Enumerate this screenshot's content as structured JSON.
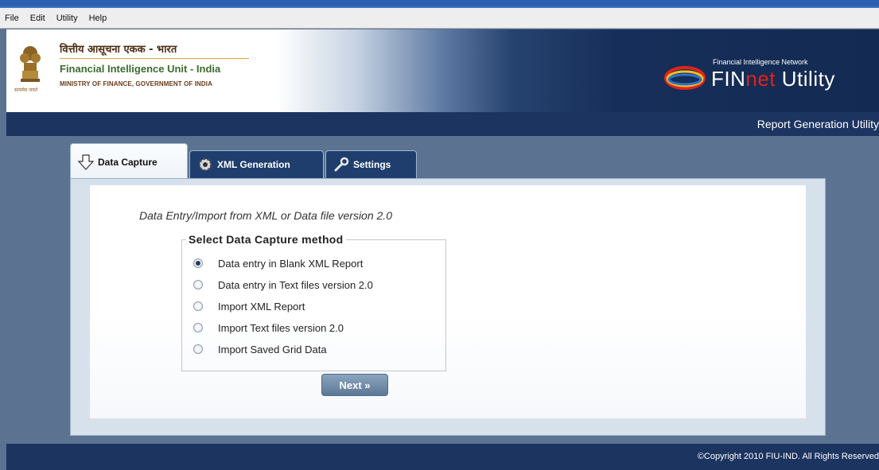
{
  "menu": {
    "file": "File",
    "edit": "Edit",
    "utility": "Utility",
    "help": "Help"
  },
  "header": {
    "hindi_title": "वित्तीय आसूचना एकक - भारत",
    "unit_name": "Financial Intelligence Unit - India",
    "ministry": "MINISTRY OF FINANCE, GOVERNMENT OF INDIA",
    "emblem_caption": "सत्यमेव जयते",
    "network_label": "Financial Intelligence Network",
    "product_fin": "FIN",
    "product_net": "net",
    "product_utility": " Utility"
  },
  "subheader": {
    "title": "Report Generation Utility"
  },
  "tabs": [
    {
      "label": "Data Capture",
      "icon": "down-arrow-icon",
      "active": true
    },
    {
      "label": "XML Generation",
      "icon": "gear-icon",
      "active": false
    },
    {
      "label": "Settings",
      "icon": "wrench-icon",
      "active": false
    }
  ],
  "content": {
    "intro": "Data Entry/Import from XML or Data file version 2.0",
    "legend": "Select Data Capture method",
    "options": [
      {
        "label": "Data entry in Blank XML Report",
        "selected": true
      },
      {
        "label": "Data entry in Text files version 2.0",
        "selected": false
      },
      {
        "label": "Import XML Report",
        "selected": false
      },
      {
        "label": "Import Text files version 2.0",
        "selected": false
      },
      {
        "label": "Import Saved Grid Data",
        "selected": false
      }
    ],
    "next_label": "Next »"
  },
  "footer": {
    "copyright": "©Copyright 2010 FIU-IND. All Rights Reserved"
  },
  "colors": {
    "background": "#5b7290",
    "dark_bar": "#1c3460",
    "accent_red": "#e2231a"
  }
}
